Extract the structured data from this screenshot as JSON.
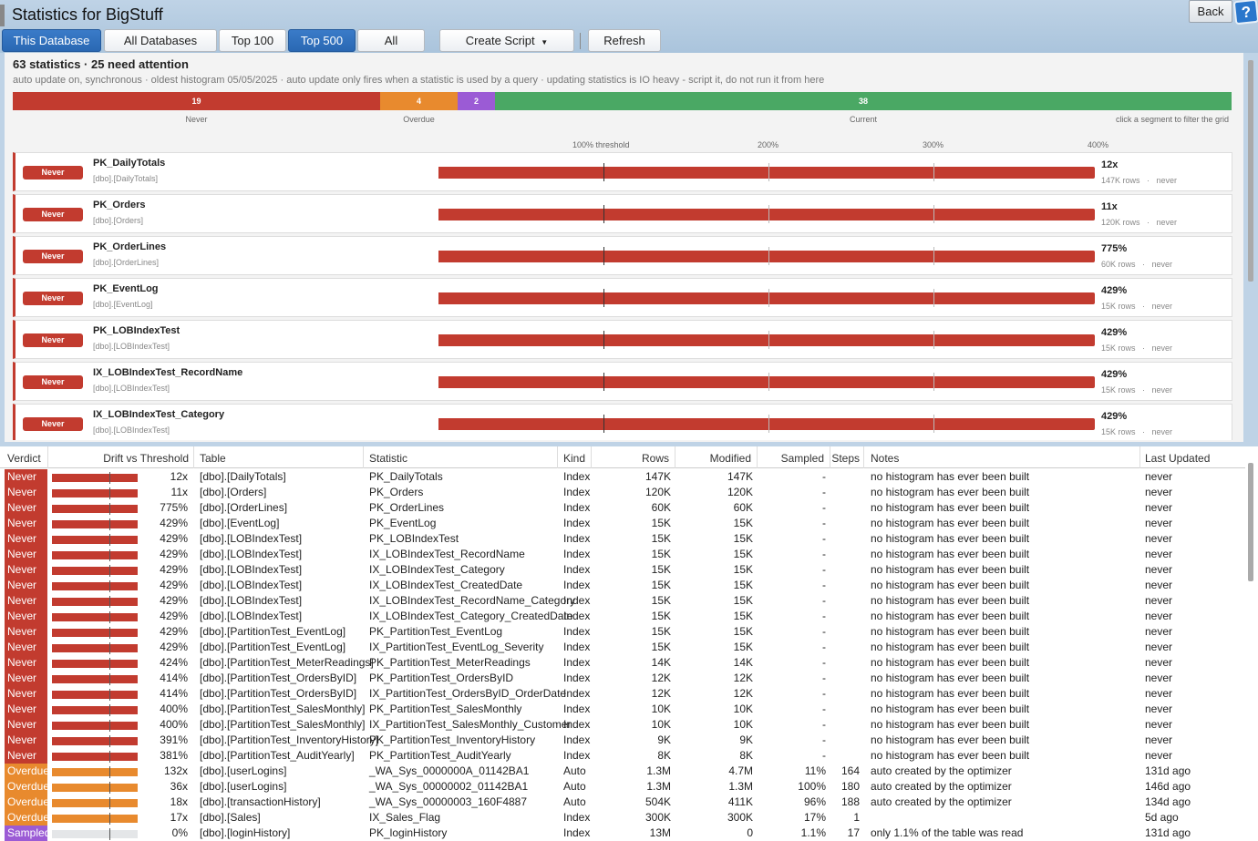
{
  "app": {
    "title": "Statistics for BigStuff"
  },
  "toolbar": {
    "this_database": "This Database",
    "all_databases": "All Databases",
    "top100": "Top 100",
    "top500": "Top 500",
    "all": "All",
    "create_script": "Create Script",
    "dropdown_glyph": "▼",
    "refresh": "Refresh",
    "back": "Back",
    "help": "?"
  },
  "summary": {
    "title": "63 statistics  ·  25 need attention",
    "subtitle": "auto update on, synchronous   ·   oldest histogram 05/05/2025   ·   auto update only fires when a statistic is used by a query   ·   updating statistics is IO heavy - script it, do not run it from here",
    "click_hint": "click a segment to filter the grid"
  },
  "segments": [
    {
      "label": "Never",
      "count": "19",
      "color": "#c23b2f"
    },
    {
      "label": "Overdue",
      "count": "4",
      "color": "#e88a2e"
    },
    {
      "label": "",
      "count": "2",
      "color": "#9b5bd5"
    },
    {
      "label": "Current",
      "count": "38",
      "color": "#4aa864"
    }
  ],
  "threshold_ticks": [
    "100% threshold",
    "200%",
    "300%",
    "400%"
  ],
  "cards": [
    {
      "verdict": "Never",
      "name": "PK_DailyTotals",
      "table": "[dbo].[DailyTotals]",
      "pct": "12x",
      "rows": "147K rows",
      "updated": "never",
      "drift_pct": 1200
    },
    {
      "verdict": "Never",
      "name": "PK_Orders",
      "table": "[dbo].[Orders]",
      "pct": "11x",
      "rows": "120K rows",
      "updated": "never",
      "drift_pct": 1100
    },
    {
      "verdict": "Never",
      "name": "PK_OrderLines",
      "table": "[dbo].[OrderLines]",
      "pct": "775%",
      "rows": "60K rows",
      "updated": "never",
      "drift_pct": 775
    },
    {
      "verdict": "Never",
      "name": "PK_EventLog",
      "table": "[dbo].[EventLog]",
      "pct": "429%",
      "rows": "15K rows",
      "updated": "never",
      "drift_pct": 429
    },
    {
      "verdict": "Never",
      "name": "PK_LOBIndexTest",
      "table": "[dbo].[LOBIndexTest]",
      "pct": "429%",
      "rows": "15K rows",
      "updated": "never",
      "drift_pct": 429
    },
    {
      "verdict": "Never",
      "name": "IX_LOBIndexTest_RecordName",
      "table": "[dbo].[LOBIndexTest]",
      "pct": "429%",
      "rows": "15K rows",
      "updated": "never",
      "drift_pct": 429
    },
    {
      "verdict": "Never",
      "name": "IX_LOBIndexTest_Category",
      "table": "[dbo].[LOBIndexTest]",
      "pct": "429%",
      "rows": "15K rows",
      "updated": "never",
      "drift_pct": 429
    }
  ],
  "grid": {
    "columns": [
      "Verdict",
      "Drift vs Threshold",
      "Table",
      "Statistic",
      "Kind",
      "Rows",
      "Modified",
      "Sampled",
      "Steps",
      "Notes",
      "Last Updated"
    ],
    "verdict_colors": {
      "Never": "#c23b2f",
      "Overdue": "#e88a2e",
      "Sampled": "#9b5bd5"
    },
    "rows": [
      {
        "verdict": "Never",
        "drift": "12x",
        "drift_frac": 1.0,
        "table": "[dbo].[DailyTotals]",
        "statistic": "PK_DailyTotals",
        "kind": "Index",
        "rows": "147K",
        "modified": "147K",
        "sampled": "-",
        "steps": "",
        "notes": "no histogram has ever been built",
        "updated": "never"
      },
      {
        "verdict": "Never",
        "drift": "11x",
        "drift_frac": 1.0,
        "table": "[dbo].[Orders]",
        "statistic": "PK_Orders",
        "kind": "Index",
        "rows": "120K",
        "modified": "120K",
        "sampled": "-",
        "steps": "",
        "notes": "no histogram has ever been built",
        "updated": "never"
      },
      {
        "verdict": "Never",
        "drift": "775%",
        "drift_frac": 1.0,
        "table": "[dbo].[OrderLines]",
        "statistic": "PK_OrderLines",
        "kind": "Index",
        "rows": "60K",
        "modified": "60K",
        "sampled": "-",
        "steps": "",
        "notes": "no histogram has ever been built",
        "updated": "never"
      },
      {
        "verdict": "Never",
        "drift": "429%",
        "drift_frac": 1.0,
        "table": "[dbo].[EventLog]",
        "statistic": "PK_EventLog",
        "kind": "Index",
        "rows": "15K",
        "modified": "15K",
        "sampled": "-",
        "steps": "",
        "notes": "no histogram has ever been built",
        "updated": "never"
      },
      {
        "verdict": "Never",
        "drift": "429%",
        "drift_frac": 1.0,
        "table": "[dbo].[LOBIndexTest]",
        "statistic": "PK_LOBIndexTest",
        "kind": "Index",
        "rows": "15K",
        "modified": "15K",
        "sampled": "-",
        "steps": "",
        "notes": "no histogram has ever been built",
        "updated": "never"
      },
      {
        "verdict": "Never",
        "drift": "429%",
        "drift_frac": 1.0,
        "table": "[dbo].[LOBIndexTest]",
        "statistic": "IX_LOBIndexTest_RecordName",
        "kind": "Index",
        "rows": "15K",
        "modified": "15K",
        "sampled": "-",
        "steps": "",
        "notes": "no histogram has ever been built",
        "updated": "never"
      },
      {
        "verdict": "Never",
        "drift": "429%",
        "drift_frac": 1.0,
        "table": "[dbo].[LOBIndexTest]",
        "statistic": "IX_LOBIndexTest_Category",
        "kind": "Index",
        "rows": "15K",
        "modified": "15K",
        "sampled": "-",
        "steps": "",
        "notes": "no histogram has ever been built",
        "updated": "never"
      },
      {
        "verdict": "Never",
        "drift": "429%",
        "drift_frac": 1.0,
        "table": "[dbo].[LOBIndexTest]",
        "statistic": "IX_LOBIndexTest_CreatedDate",
        "kind": "Index",
        "rows": "15K",
        "modified": "15K",
        "sampled": "-",
        "steps": "",
        "notes": "no histogram has ever been built",
        "updated": "never"
      },
      {
        "verdict": "Never",
        "drift": "429%",
        "drift_frac": 1.0,
        "table": "[dbo].[LOBIndexTest]",
        "statistic": "IX_LOBIndexTest_RecordName_Category",
        "kind": "Index",
        "rows": "15K",
        "modified": "15K",
        "sampled": "-",
        "steps": "",
        "notes": "no histogram has ever been built",
        "updated": "never"
      },
      {
        "verdict": "Never",
        "drift": "429%",
        "drift_frac": 1.0,
        "table": "[dbo].[LOBIndexTest]",
        "statistic": "IX_LOBIndexTest_Category_CreatedDate",
        "kind": "Index",
        "rows": "15K",
        "modified": "15K",
        "sampled": "-",
        "steps": "",
        "notes": "no histogram has ever been built",
        "updated": "never"
      },
      {
        "verdict": "Never",
        "drift": "429%",
        "drift_frac": 1.0,
        "table": "[dbo].[PartitionTest_EventLog]",
        "statistic": "PK_PartitionTest_EventLog",
        "kind": "Index",
        "rows": "15K",
        "modified": "15K",
        "sampled": "-",
        "steps": "",
        "notes": "no histogram has ever been built",
        "updated": "never"
      },
      {
        "verdict": "Never",
        "drift": "429%",
        "drift_frac": 1.0,
        "table": "[dbo].[PartitionTest_EventLog]",
        "statistic": "IX_PartitionTest_EventLog_Severity",
        "kind": "Index",
        "rows": "15K",
        "modified": "15K",
        "sampled": "-",
        "steps": "",
        "notes": "no histogram has ever been built",
        "updated": "never"
      },
      {
        "verdict": "Never",
        "drift": "424%",
        "drift_frac": 1.0,
        "table": "[dbo].[PartitionTest_MeterReadings]",
        "statistic": "PK_PartitionTest_MeterReadings",
        "kind": "Index",
        "rows": "14K",
        "modified": "14K",
        "sampled": "-",
        "steps": "",
        "notes": "no histogram has ever been built",
        "updated": "never"
      },
      {
        "verdict": "Never",
        "drift": "414%",
        "drift_frac": 1.0,
        "table": "[dbo].[PartitionTest_OrdersByID]",
        "statistic": "PK_PartitionTest_OrdersByID",
        "kind": "Index",
        "rows": "12K",
        "modified": "12K",
        "sampled": "-",
        "steps": "",
        "notes": "no histogram has ever been built",
        "updated": "never"
      },
      {
        "verdict": "Never",
        "drift": "414%",
        "drift_frac": 1.0,
        "table": "[dbo].[PartitionTest_OrdersByID]",
        "statistic": "IX_PartitionTest_OrdersByID_OrderDate",
        "kind": "Index",
        "rows": "12K",
        "modified": "12K",
        "sampled": "-",
        "steps": "",
        "notes": "no histogram has ever been built",
        "updated": "never"
      },
      {
        "verdict": "Never",
        "drift": "400%",
        "drift_frac": 1.0,
        "table": "[dbo].[PartitionTest_SalesMonthly]",
        "statistic": "PK_PartitionTest_SalesMonthly",
        "kind": "Index",
        "rows": "10K",
        "modified": "10K",
        "sampled": "-",
        "steps": "",
        "notes": "no histogram has ever been built",
        "updated": "never"
      },
      {
        "verdict": "Never",
        "drift": "400%",
        "drift_frac": 1.0,
        "table": "[dbo].[PartitionTest_SalesMonthly]",
        "statistic": "IX_PartitionTest_SalesMonthly_Customer",
        "kind": "Index",
        "rows": "10K",
        "modified": "10K",
        "sampled": "-",
        "steps": "",
        "notes": "no histogram has ever been built",
        "updated": "never"
      },
      {
        "verdict": "Never",
        "drift": "391%",
        "drift_frac": 1.0,
        "table": "[dbo].[PartitionTest_InventoryHistory]",
        "statistic": "PK_PartitionTest_InventoryHistory",
        "kind": "Index",
        "rows": "9K",
        "modified": "9K",
        "sampled": "-",
        "steps": "",
        "notes": "no histogram has ever been built",
        "updated": "never"
      },
      {
        "verdict": "Never",
        "drift": "381%",
        "drift_frac": 1.0,
        "table": "[dbo].[PartitionTest_AuditYearly]",
        "statistic": "PK_PartitionTest_AuditYearly",
        "kind": "Index",
        "rows": "8K",
        "modified": "8K",
        "sampled": "-",
        "steps": "",
        "notes": "no histogram has ever been built",
        "updated": "never"
      },
      {
        "verdict": "Overdue",
        "drift": "132x",
        "drift_frac": 1.0,
        "table": "[dbo].[userLogins]",
        "statistic": "_WA_Sys_0000000A_01142BA1",
        "kind": "Auto",
        "rows": "1.3M",
        "modified": "4.7M",
        "sampled": "11%",
        "steps": "164",
        "notes": "auto created by the optimizer",
        "updated": "131d ago"
      },
      {
        "verdict": "Overdue",
        "drift": "36x",
        "drift_frac": 1.0,
        "table": "[dbo].[userLogins]",
        "statistic": "_WA_Sys_00000002_01142BA1",
        "kind": "Auto",
        "rows": "1.3M",
        "modified": "1.3M",
        "sampled": "100%",
        "steps": "180",
        "notes": "auto created by the optimizer",
        "updated": "146d ago"
      },
      {
        "verdict": "Overdue",
        "drift": "18x",
        "drift_frac": 1.0,
        "table": "[dbo].[transactionHistory]",
        "statistic": "_WA_Sys_00000003_160F4887",
        "kind": "Auto",
        "rows": "504K",
        "modified": "411K",
        "sampled": "96%",
        "steps": "188",
        "notes": "auto created by the optimizer",
        "updated": "134d ago"
      },
      {
        "verdict": "Overdue",
        "drift": "17x",
        "drift_frac": 1.0,
        "table": "[dbo].[Sales]",
        "statistic": "IX_Sales_Flag",
        "kind": "Index",
        "rows": "300K",
        "modified": "300K",
        "sampled": "17%",
        "steps": "1",
        "notes": "",
        "updated": "5d ago"
      },
      {
        "verdict": "Sampled",
        "drift": "0%",
        "drift_frac": 0.0,
        "table": "[dbo].[loginHistory]",
        "statistic": "PK_loginHistory",
        "kind": "Index",
        "rows": "13M",
        "modified": "0",
        "sampled": "1.1%",
        "steps": "17",
        "notes": "only 1.1% of the table was read",
        "updated": "131d ago"
      }
    ]
  }
}
